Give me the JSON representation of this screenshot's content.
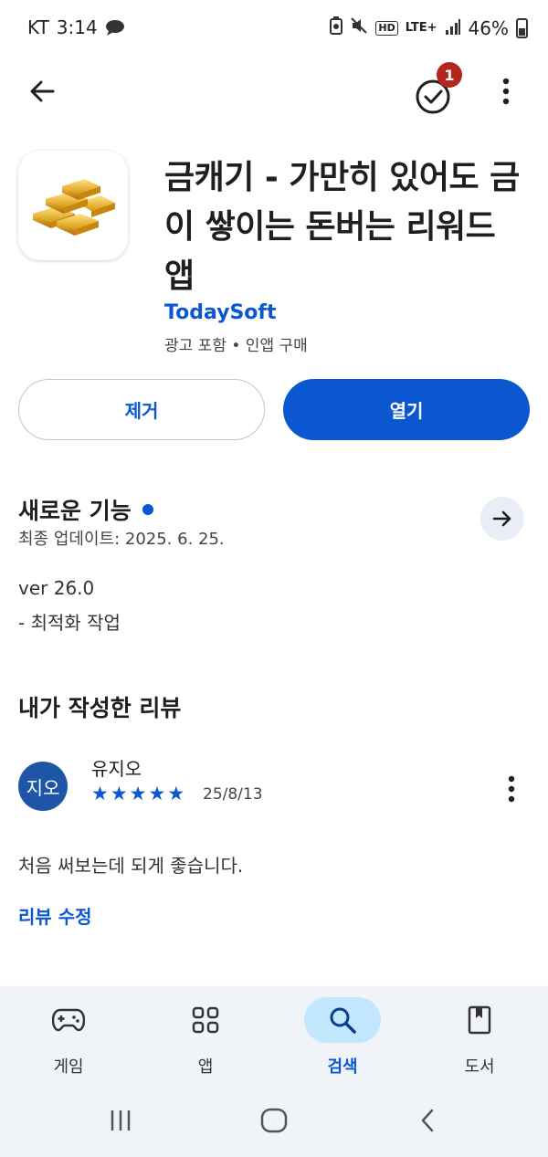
{
  "status_bar": {
    "carrier": "KT",
    "time": "3:14",
    "network": "LTE+",
    "hd": "HD",
    "battery": "46%"
  },
  "top_bar": {
    "notification_count": "1"
  },
  "app": {
    "title": "금캐기 - 가만히 있어도 금이 쌓이는 돈버는 리워드 앱",
    "developer": "TodaySoft",
    "meta": "광고 포함 • 인앱 구매"
  },
  "actions": {
    "uninstall_label": "제거",
    "open_label": "열기"
  },
  "whats_new": {
    "title": "새로운 기능",
    "updated": "최종 업데이트: 2025. 6. 25.",
    "version": "ver 26.0",
    "changes": "- 최적화 작업"
  },
  "my_review": {
    "section_title": "내가 작성한 리뷰",
    "avatar_text": "지오",
    "reviewer": "유지오",
    "rating": 5,
    "date": "25/8/13",
    "text": "처음 써보는데 되게 좋습니다.",
    "edit_label": "리뷰 수정"
  },
  "bottom_nav": {
    "items": [
      {
        "label": "게임",
        "icon": "gamepad-icon",
        "active": false
      },
      {
        "label": "앱",
        "icon": "apps-grid-icon",
        "active": false
      },
      {
        "label": "검색",
        "icon": "search-icon",
        "active": true
      },
      {
        "label": "도서",
        "icon": "book-icon",
        "active": false
      }
    ]
  },
  "colors": {
    "accent": "#0b57d0",
    "badge": "#b3261e",
    "nav_bg": "#f0f4f9",
    "active_pill": "#c2e7ff",
    "avatar": "#1f55a6"
  }
}
